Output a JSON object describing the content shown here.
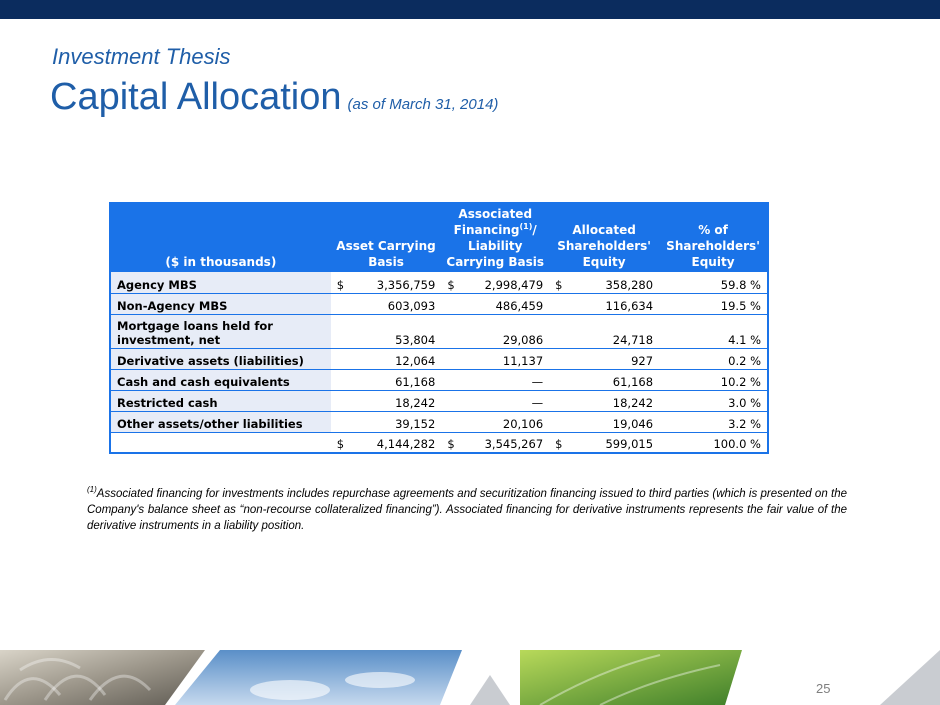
{
  "header": {
    "subtitle": "Investment Thesis",
    "title": "Capital Allocation",
    "as_of": "(as of March 31, 2014)"
  },
  "table": {
    "columns": {
      "label": "($ in thousands)",
      "asset": "Asset Carrying Basis",
      "financing_pre": "Associated Financing",
      "financing_sup": "(1)",
      "financing_post": "/ Liability Carrying Basis",
      "equity": "Allocated Shareholders' Equity",
      "pct": "% of Shareholders' Equity"
    },
    "rows": [
      {
        "label": "Agency MBS",
        "asset_cur": "$",
        "asset": "3,356,759",
        "fin_cur": "$",
        "financing": "2,998,479",
        "eq_cur": "$",
        "equity": "358,280",
        "pct": "59.8 %"
      },
      {
        "label": "Non-Agency MBS",
        "asset_cur": "",
        "asset": "603,093",
        "fin_cur": "",
        "financing": "486,459",
        "eq_cur": "",
        "equity": "116,634",
        "pct": "19.5 %"
      },
      {
        "label": "Mortgage loans held for investment, net",
        "asset_cur": "",
        "asset": "53,804",
        "fin_cur": "",
        "financing": "29,086",
        "eq_cur": "",
        "equity": "24,718",
        "pct": "4.1 %"
      },
      {
        "label": "Derivative assets (liabilities)",
        "asset_cur": "",
        "asset": "12,064",
        "fin_cur": "",
        "financing": "11,137",
        "eq_cur": "",
        "equity": "927",
        "pct": "0.2 %"
      },
      {
        "label": "Cash and cash equivalents",
        "asset_cur": "",
        "asset": "61,168",
        "fin_cur": "",
        "financing": "—",
        "eq_cur": "",
        "equity": "61,168",
        "pct": "10.2 %"
      },
      {
        "label": "Restricted cash",
        "asset_cur": "",
        "asset": "18,242",
        "fin_cur": "",
        "financing": "—",
        "eq_cur": "",
        "equity": "18,242",
        "pct": "3.0 %"
      },
      {
        "label": "Other assets/other liabilities",
        "asset_cur": "",
        "asset": "39,152",
        "fin_cur": "",
        "financing": "20,106",
        "eq_cur": "",
        "equity": "19,046",
        "pct": "3.2 %"
      }
    ],
    "total": {
      "label": "",
      "asset_cur": "$",
      "asset": "4,144,282",
      "fin_cur": "$",
      "financing": "3,545,267",
      "eq_cur": "$",
      "equity": "599,015",
      "pct": "100.0 %"
    }
  },
  "footnote": {
    "marker": "(1)",
    "text": "Associated financing for investments includes repurchase agreements and securitization financing issued to third parties (which is presented on the Company's balance sheet as “non-recourse collateralized financing”). Associated financing for derivative instruments represents the fair value of the derivative instruments in a liability position."
  },
  "page_number": "25",
  "colors": {
    "top_bar": "#0b2c5e",
    "title": "#1f5ea8",
    "table_header": "#1a73e8",
    "row_label_bg": "#e7ecf7"
  }
}
